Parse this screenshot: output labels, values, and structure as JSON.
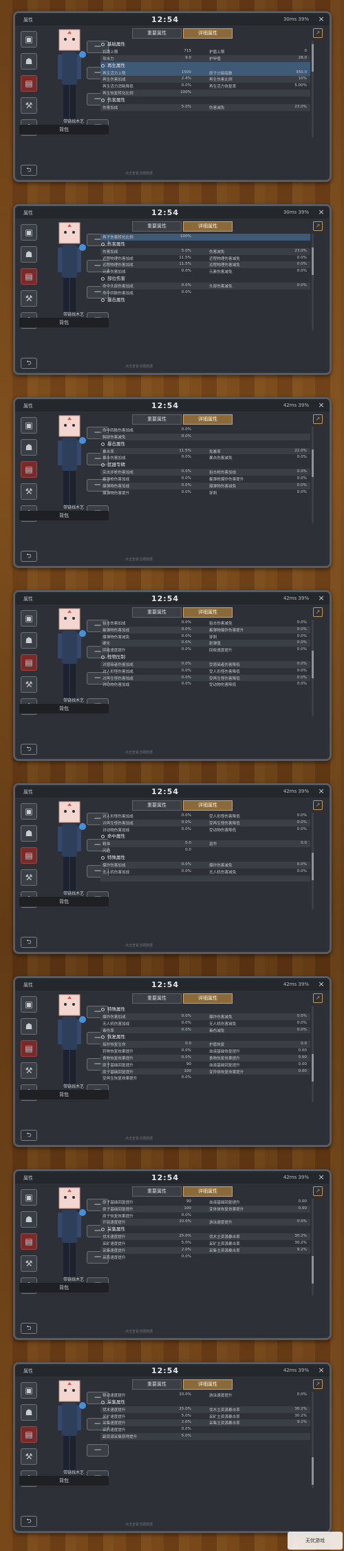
{
  "topbar": {
    "title": "属性",
    "time": "12:54",
    "close": "×"
  },
  "tabs": [
    "重要属性",
    "详细属性"
  ],
  "backpack_label": "背包",
  "equip_label": "带链线木艺",
  "footer_tip": "点击查看详细数据",
  "slots": {
    "left": [
      "▣",
      "☗",
      "▤",
      "⚒",
      "⚘"
    ],
    "right": [
      "═══",
      "═══",
      "═══",
      "═══"
    ]
  },
  "icons": {
    "share": "↗",
    "back": "⮌"
  },
  "accent": "#8a6a3a",
  "watermark": "无忧游戏",
  "panels": [
    {
      "status": "30ms   39%",
      "scroll": 0.05,
      "rows": [
        {
          "type": "h",
          "label": "基础属性"
        },
        {
          "type": "r",
          "cells": [
            "饥饿上限",
            "715",
            "护盾上限",
            "0"
          ]
        },
        {
          "type": "r",
          "alt": true,
          "cells": [
            "攻击力",
            "9.0",
            "护甲值",
            "28.0"
          ]
        },
        {
          "type": "h",
          "label": "再生属性",
          "hl": true
        },
        {
          "type": "r",
          "hl": true,
          "cells": [
            "再生活力上限",
            "1500",
            "原子分裂指数",
            "350.0"
          ]
        },
        {
          "type": "r",
          "alt": true,
          "cells": [
            "再生伤害加成",
            "2.4%",
            "再生伤害比例",
            "10%"
          ]
        },
        {
          "type": "r",
          "cells": [
            "再生活力消耗降低",
            "0.0%",
            "再生活力恢复率",
            "5.00%"
          ]
        },
        {
          "type": "r",
          "alt": true,
          "cells": [
            "再生恢复转化比例",
            "100%",
            "",
            ""
          ]
        },
        {
          "type": "h",
          "label": "伤害属性"
        },
        {
          "type": "r",
          "alt": true,
          "cells": [
            "伤害加成",
            "5.0%",
            "伤害减免",
            "23.0%"
          ]
        }
      ]
    },
    {
      "status": "30ms   39%",
      "scroll": 0.2,
      "rows": [
        {
          "type": "r",
          "hl": true,
          "cells": [
            "再子伤害转化比例",
            "100%",
            "",
            ""
          ]
        },
        {
          "type": "h",
          "label": "伤害属性"
        },
        {
          "type": "r",
          "alt": true,
          "cells": [
            "伤害加成",
            "5.0%",
            "伤害减免",
            "23.0%"
          ]
        },
        {
          "type": "r",
          "cells": [
            "近程物理伤害加成",
            "11.5%",
            "近程物理伤害减免",
            "0.0%"
          ]
        },
        {
          "type": "r",
          "alt": true,
          "cells": [
            "远程物理伤害加成",
            "11.5%",
            "远程物理伤害减免",
            "0.0%"
          ]
        },
        {
          "type": "r",
          "cells": [
            "元素伤害加成",
            "0.0%",
            "元素伤害减免",
            "0.0%"
          ]
        },
        {
          "type": "h",
          "label": "部位伤害"
        },
        {
          "type": "r",
          "alt": true,
          "cells": [
            "命中头部伤害加成",
            "0.0%",
            "头部伤害减免",
            "0.0%"
          ]
        },
        {
          "type": "r",
          "cells": [
            "命中四肢伤害加成",
            "0.0%",
            "",
            ""
          ]
        },
        {
          "type": "h",
          "label": "暴击属性"
        }
      ]
    },
    {
      "status": "42ms   39%",
      "scroll": 0.33,
      "rows": [
        {
          "type": "r",
          "cells": [
            "命中四肢伤害加成",
            "0.0%",
            "",
            ""
          ]
        },
        {
          "type": "r",
          "alt": true,
          "cells": [
            "胸部伤害减免",
            "0.0%",
            "",
            ""
          ]
        },
        {
          "type": "h",
          "label": "暴击属性"
        },
        {
          "type": "r",
          "alt": true,
          "cells": [
            "暴击率",
            "11.5%",
            "免暴率",
            "22.0%"
          ]
        },
        {
          "type": "r",
          "cells": [
            "暴击伤害加成",
            "0.0%",
            "暴击伤害减免",
            "0.0%"
          ]
        },
        {
          "type": "h",
          "label": "武器专精"
        },
        {
          "type": "r",
          "alt": true,
          "cells": [
            "突击步枪伤害加成",
            "0.0%",
            "狙击枪伤害加成",
            "0.0%"
          ]
        },
        {
          "type": "r",
          "cells": [
            "霰弹枪伤害加成",
            "0.0%",
            "霰弹枪爆炸伤害提升",
            "0.0%"
          ]
        },
        {
          "type": "r",
          "alt": true,
          "cells": [
            "爆弹物伤害加成",
            "0.0%",
            "爆弹物伤害减免",
            "0.0%"
          ]
        },
        {
          "type": "r",
          "cells": [
            "爆弹物伤害提升",
            "0.0%",
            "穿刺",
            "0.0%"
          ]
        }
      ]
    },
    {
      "status": "42ms   39%",
      "scroll": 0.45,
      "rows": [
        {
          "type": "r",
          "cells": [
            "狙击伤害加成",
            "0.0%",
            "狙击伤害减免",
            "0.0%"
          ]
        },
        {
          "type": "r",
          "alt": true,
          "cells": [
            "霰弹物伤害加成",
            "0.0%",
            "霰弹物爆炸伤害提升",
            "0.0%"
          ]
        },
        {
          "type": "r",
          "cells": [
            "爆弹物伤害减免",
            "0.0%",
            "穿刺",
            "0.0%"
          ]
        },
        {
          "type": "r",
          "alt": true,
          "cells": [
            "硬化",
            "0.0%",
            "耐弹值",
            "0.0%"
          ]
        },
        {
          "type": "r",
          "cells": [
            "回收速度提升",
            "0.0%",
            "回收速度提升",
            "0.0%"
          ]
        },
        {
          "type": "h",
          "label": "怪物压制"
        },
        {
          "type": "r",
          "alt": true,
          "cells": [
            "对感染者伤害加成",
            "0.0%",
            "受感染者伤害降低",
            "0.0%"
          ]
        },
        {
          "type": "r",
          "cells": [
            "对人形怪伤害加成",
            "0.0%",
            "受人形怪伤害降低",
            "0.0%"
          ]
        },
        {
          "type": "r",
          "alt": true,
          "cells": [
            "对再生怪伤害加成",
            "0.0%",
            "受再生怪伤害降低",
            "0.0%"
          ]
        },
        {
          "type": "r",
          "cells": [
            "对动物伤害加成",
            "0.0%",
            "受动物伤害降低",
            "0.0%"
          ]
        }
      ]
    },
    {
      "status": "42ms   39%",
      "scroll": 0.58,
      "rows": [
        {
          "type": "r",
          "cells": [
            "对人形怪伤害加成",
            "0.0%",
            "受人形怪伤害降低",
            "0.0%"
          ]
        },
        {
          "type": "r",
          "alt": true,
          "cells": [
            "对再生怪伤害加成",
            "0.0%",
            "受再生怪伤害降低",
            "0.0%"
          ]
        },
        {
          "type": "r",
          "cells": [
            "对动物伤害加成",
            "0.0%",
            "受动物伤害降低",
            "0.0%"
          ]
        },
        {
          "type": "h",
          "label": "命中属性"
        },
        {
          "type": "r",
          "alt": true,
          "cells": [
            "精准",
            "0.0",
            "逗华",
            "0.0"
          ]
        },
        {
          "type": "r",
          "cells": [
            "闪避",
            "0.0",
            "",
            ""
          ]
        },
        {
          "type": "h",
          "label": "特殊属性"
        },
        {
          "type": "r",
          "alt": true,
          "cells": [
            "爆炸伤害加成",
            "0.0%",
            "爆炸伤害减免",
            "0.0%"
          ]
        },
        {
          "type": "r",
          "cells": [
            "无人机伤害加成",
            "0.0%",
            "无人机伤害减免",
            "0.0%"
          ]
        },
        {
          "type": "r",
          "alt": true,
          "cells": [
            "",
            "",
            "",
            ""
          ]
        }
      ]
    },
    {
      "status": "42ms   39%",
      "scroll": 0.7,
      "rows": [
        {
          "type": "h",
          "label": "特殊属性"
        },
        {
          "type": "r",
          "alt": true,
          "cells": [
            "爆炸伤害加成",
            "0.0%",
            "爆炸伤害减免",
            "0.0%"
          ]
        },
        {
          "type": "r",
          "cells": [
            "无人机伤害加成",
            "0.0%",
            "无人机伤害减免",
            "0.0%"
          ]
        },
        {
          "type": "r",
          "alt": true,
          "cells": [
            "毒伤率",
            "0.0%",
            "毒伤减免",
            "0.0%"
          ]
        },
        {
          "type": "h",
          "label": "恢复属性"
        },
        {
          "type": "r",
          "alt": true,
          "cells": [
            "每秒恢复生命",
            "0.0",
            "护盾恢复",
            "0.0"
          ]
        },
        {
          "type": "r",
          "cells": [
            "药物恢复效果提升",
            "0.0%",
            "血液基础恢复提升",
            "0.00"
          ]
        },
        {
          "type": "r",
          "alt": true,
          "cells": [
            "食物恢复效果提升",
            "0.0%",
            "食物恢复效果提升",
            "0.00"
          ]
        },
        {
          "type": "r",
          "cells": [
            "原子基础回复提升",
            "90",
            "血液基础回复提升",
            "0.00"
          ]
        },
        {
          "type": "r",
          "alt": true,
          "cells": [
            "原子基础回复提升",
            "100",
            "变异体恢复效果提升",
            "0.00"
          ]
        },
        {
          "type": "r",
          "cells": [
            "受再生恢复效果提升",
            "0.0%",
            "",
            ""
          ]
        }
      ]
    },
    {
      "status": "42ms   39%",
      "scroll": 0.83,
      "rows": [
        {
          "type": "r",
          "cells": [
            "原子基础回复提升",
            "90",
            "血液基础回复提升",
            "0.00"
          ]
        },
        {
          "type": "r",
          "alt": true,
          "cells": [
            "原子基础回复提升",
            "100",
            "变体体恢复效果提升",
            "0.00"
          ]
        },
        {
          "type": "r",
          "cells": [
            "原子恢复效果提升",
            "0.0%",
            "",
            ""
          ]
        },
        {
          "type": "r",
          "alt": true,
          "cells": [
            "开铭速度提升",
            "10.0%",
            "游泳速度提升",
            "0.0%"
          ]
        },
        {
          "type": "h",
          "label": "采集属性"
        },
        {
          "type": "r",
          "alt": true,
          "cells": [
            "伐木速度提升",
            "25.0%",
            "伐木主资源暴击率",
            "30.2%"
          ]
        },
        {
          "type": "r",
          "cells": [
            "采矿速度提升",
            "5.0%",
            "采矿主资源暴击率",
            "30.2%"
          ]
        },
        {
          "type": "r",
          "alt": true,
          "cells": [
            "采集速度提升",
            "2.0%",
            "采集主资源暴击率",
            "9.2%"
          ]
        },
        {
          "type": "r",
          "cells": [
            "采药速度提升",
            "0.0%",
            "",
            ""
          ]
        }
      ]
    },
    {
      "status": "42ms   39%",
      "scroll": 0.95,
      "rows": [
        {
          "type": "r",
          "cells": [
            "移动速度提升",
            "10.0%",
            "游泳速度提升",
            "0.0%"
          ]
        },
        {
          "type": "h",
          "label": "采集属性"
        },
        {
          "type": "r",
          "alt": true,
          "cells": [
            "伐木速度提升",
            "25.0%",
            "伐木主资源暴击率",
            "30.2%"
          ]
        },
        {
          "type": "r",
          "cells": [
            "采矿速度提升",
            "5.0%",
            "采矿主资源暴击率",
            "30.2%"
          ]
        },
        {
          "type": "r",
          "alt": true,
          "cells": [
            "采集速度提升",
            "2.0%",
            "采集主资源暴击率",
            "9.2%"
          ]
        },
        {
          "type": "r",
          "cells": [
            "采药速度提升",
            "0.0%",
            "",
            ""
          ]
        },
        {
          "type": "r",
          "alt": true,
          "cells": [
            "副资源采集获得提升",
            "5.0%",
            "",
            ""
          ]
        }
      ]
    }
  ]
}
